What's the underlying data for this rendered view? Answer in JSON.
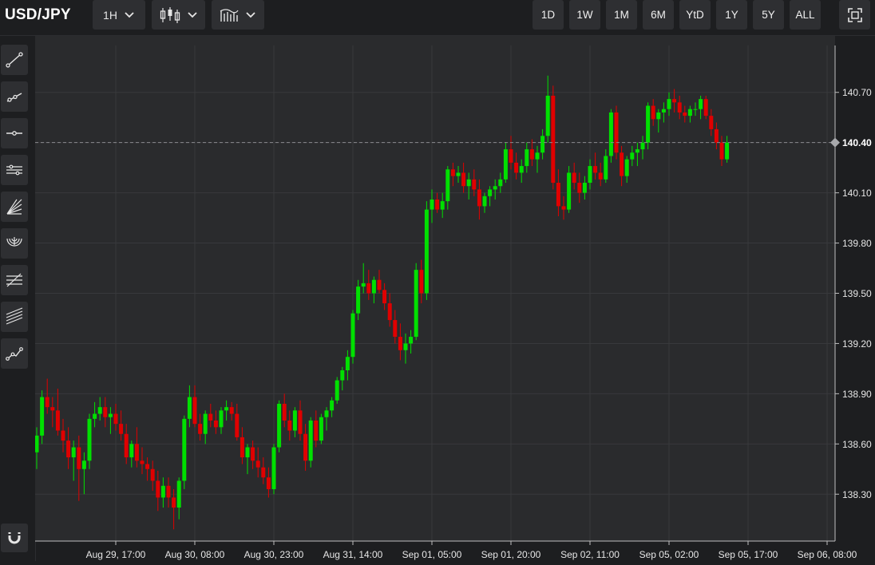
{
  "header": {
    "symbol": "USD/JPY",
    "interval_label": "1H",
    "chart_type_icon": "candlestick-icon",
    "indicators_icon": "indicators-icon",
    "ranges": [
      "1D",
      "1W",
      "1M",
      "6M",
      "YtD",
      "1Y",
      "5Y",
      "ALL"
    ],
    "fullscreen_icon": "fullscreen-icon"
  },
  "sidebar": {
    "tools": [
      "trend-line-icon",
      "ray-line-icon",
      "horizontal-line-icon",
      "parallel-channel-icon",
      "fan-lines-icon",
      "fibonacci-arc-icon",
      "fibonacci-retracement-icon",
      "fibonacci-channel-icon",
      "path-line-icon"
    ],
    "magnet_icon": "magnet-icon"
  },
  "chart_data": {
    "type": "candlestick",
    "title": "USD/JPY",
    "xlabel": "",
    "ylabel": "",
    "y_ticks": [
      138.3,
      138.6,
      138.9,
      139.2,
      139.5,
      139.8,
      140.1,
      140.4,
      140.7
    ],
    "y_tick_labels": [
      "138.30",
      "138.60",
      "138.90",
      "139.20",
      "139.50",
      "139.80",
      "140.10",
      "140.40",
      "140.70"
    ],
    "ylim": [
      138.02,
      140.98
    ],
    "x_tick_labels": [
      "Aug 29, 17:00",
      "Aug 30, 08:00",
      "Aug 30, 23:00",
      "Aug 31, 14:00",
      "Sep 01, 05:00",
      "Sep 01, 20:00",
      "Sep 02, 11:00",
      "Sep 05, 02:00",
      "Sep 05, 17:00",
      "Sep 06, 08:00"
    ],
    "x_tick_candle_index": [
      15,
      30,
      45,
      60,
      75,
      90,
      105,
      120,
      135,
      150
    ],
    "current_price": 140.4,
    "current_price_label": "140.40",
    "up_color": "#00e000",
    "down_color": "#e00000",
    "grid": true,
    "candles": [
      [
        138.55,
        138.7,
        138.45,
        138.65
      ],
      [
        138.65,
        138.92,
        138.6,
        138.88
      ],
      [
        138.88,
        138.99,
        138.78,
        138.82
      ],
      [
        138.82,
        138.88,
        138.7,
        138.8
      ],
      [
        138.8,
        138.93,
        138.65,
        138.68
      ],
      [
        138.68,
        138.75,
        138.55,
        138.62
      ],
      [
        138.62,
        138.7,
        138.45,
        138.52
      ],
      [
        138.52,
        138.62,
        138.38,
        138.58
      ],
      [
        138.58,
        138.65,
        138.26,
        138.45
      ],
      [
        138.45,
        138.55,
        138.3,
        138.5
      ],
      [
        138.5,
        138.78,
        138.45,
        138.75
      ],
      [
        138.75,
        138.85,
        138.7,
        138.78
      ],
      [
        138.78,
        138.88,
        138.74,
        138.82
      ],
      [
        138.82,
        138.88,
        138.7,
        138.76
      ],
      [
        138.76,
        138.82,
        138.66,
        138.78
      ],
      [
        138.78,
        138.84,
        138.68,
        138.72
      ],
      [
        138.72,
        138.8,
        138.62,
        138.66
      ],
      [
        138.66,
        138.72,
        138.48,
        138.52
      ],
      [
        138.52,
        138.62,
        138.46,
        138.6
      ],
      [
        138.6,
        138.7,
        138.46,
        138.5
      ],
      [
        138.5,
        138.58,
        138.42,
        138.48
      ],
      [
        138.48,
        138.52,
        138.38,
        138.45
      ],
      [
        138.45,
        138.5,
        138.32,
        138.38
      ],
      [
        138.38,
        138.44,
        138.2,
        138.28
      ],
      [
        138.28,
        138.4,
        138.22,
        138.35
      ],
      [
        138.35,
        138.4,
        138.22,
        138.28
      ],
      [
        138.28,
        138.33,
        138.09,
        138.22
      ],
      [
        138.22,
        138.4,
        138.15,
        138.38
      ],
      [
        138.38,
        138.77,
        138.33,
        138.75
      ],
      [
        138.75,
        138.95,
        138.7,
        138.88
      ],
      [
        138.88,
        138.95,
        138.7,
        138.72
      ],
      [
        138.72,
        138.78,
        138.62,
        138.66
      ],
      [
        138.66,
        138.8,
        138.6,
        138.78
      ],
      [
        138.78,
        138.84,
        138.7,
        138.74
      ],
      [
        138.74,
        138.8,
        138.66,
        138.7
      ],
      [
        138.7,
        138.82,
        138.66,
        138.8
      ],
      [
        138.8,
        138.86,
        138.74,
        138.82
      ],
      [
        138.82,
        138.85,
        138.74,
        138.78
      ],
      [
        138.78,
        138.84,
        138.62,
        138.64
      ],
      [
        138.64,
        138.7,
        138.48,
        138.52
      ],
      [
        138.52,
        138.6,
        138.42,
        138.58
      ],
      [
        138.58,
        138.62,
        138.45,
        138.5
      ],
      [
        138.5,
        138.58,
        138.4,
        138.46
      ],
      [
        138.46,
        138.52,
        138.36,
        138.4
      ],
      [
        138.4,
        138.46,
        138.28,
        138.33
      ],
      [
        138.33,
        138.6,
        138.3,
        138.58
      ],
      [
        138.58,
        138.86,
        138.55,
        138.84
      ],
      [
        138.84,
        138.9,
        138.7,
        138.74
      ],
      [
        138.74,
        138.8,
        138.62,
        138.68
      ],
      [
        138.68,
        138.82,
        138.64,
        138.8
      ],
      [
        138.8,
        138.86,
        138.62,
        138.66
      ],
      [
        138.66,
        138.72,
        138.44,
        138.5
      ],
      [
        138.5,
        138.76,
        138.46,
        138.74
      ],
      [
        138.74,
        138.8,
        138.58,
        138.62
      ],
      [
        138.62,
        138.78,
        138.6,
        138.76
      ],
      [
        138.76,
        138.82,
        138.68,
        138.8
      ],
      [
        138.8,
        138.88,
        138.76,
        138.86
      ],
      [
        138.86,
        139.0,
        138.84,
        138.98
      ],
      [
        138.98,
        139.06,
        138.92,
        139.04
      ],
      [
        139.04,
        139.16,
        138.98,
        139.12
      ],
      [
        139.12,
        139.4,
        139.08,
        139.38
      ],
      [
        139.38,
        139.58,
        139.34,
        139.54
      ],
      [
        139.54,
        139.68,
        139.5,
        139.56
      ],
      [
        139.56,
        139.64,
        139.46,
        139.5
      ],
      [
        139.5,
        139.6,
        139.44,
        139.58
      ],
      [
        139.58,
        139.64,
        139.5,
        139.52
      ],
      [
        139.52,
        139.56,
        139.4,
        139.44
      ],
      [
        139.44,
        139.5,
        139.3,
        139.34
      ],
      [
        139.34,
        139.4,
        139.2,
        139.24
      ],
      [
        139.24,
        139.32,
        139.1,
        139.16
      ],
      [
        139.16,
        139.26,
        139.08,
        139.2
      ],
      [
        139.2,
        139.28,
        139.14,
        139.24
      ],
      [
        139.24,
        139.68,
        139.22,
        139.64
      ],
      [
        139.64,
        139.7,
        139.44,
        139.5
      ],
      [
        139.5,
        140.05,
        139.46,
        140.0
      ],
      [
        140.0,
        140.12,
        139.92,
        140.06
      ],
      [
        140.06,
        140.1,
        139.98,
        140.0
      ],
      [
        140.0,
        140.1,
        139.95,
        140.05
      ],
      [
        140.05,
        140.26,
        140.0,
        140.24
      ],
      [
        140.24,
        140.28,
        140.14,
        140.2
      ],
      [
        140.2,
        140.26,
        140.16,
        140.22
      ],
      [
        140.22,
        140.28,
        140.1,
        140.14
      ],
      [
        140.14,
        140.22,
        140.06,
        140.18
      ],
      [
        140.18,
        140.24,
        140.08,
        140.12
      ],
      [
        140.12,
        140.18,
        139.94,
        140.02
      ],
      [
        140.02,
        140.1,
        139.98,
        140.08
      ],
      [
        140.08,
        140.14,
        140.02,
        140.12
      ],
      [
        140.12,
        140.18,
        140.06,
        140.14
      ],
      [
        140.14,
        140.22,
        140.1,
        140.18
      ],
      [
        140.18,
        140.4,
        140.16,
        140.36
      ],
      [
        140.36,
        140.44,
        140.24,
        140.28
      ],
      [
        140.28,
        140.34,
        140.18,
        140.22
      ],
      [
        140.22,
        140.3,
        140.16,
        140.26
      ],
      [
        140.26,
        140.4,
        140.22,
        140.36
      ],
      [
        140.36,
        140.42,
        140.26,
        140.3
      ],
      [
        140.3,
        140.38,
        140.22,
        140.34
      ],
      [
        140.34,
        140.48,
        140.3,
        140.44
      ],
      [
        140.44,
        140.8,
        140.4,
        140.68
      ],
      [
        140.68,
        140.74,
        140.12,
        140.16
      ],
      [
        140.16,
        140.24,
        139.96,
        140.02
      ],
      [
        140.02,
        140.08,
        139.94,
        140.0
      ],
      [
        140.0,
        140.26,
        139.98,
        140.22
      ],
      [
        140.22,
        140.28,
        140.12,
        140.16
      ],
      [
        140.16,
        140.22,
        140.04,
        140.1
      ],
      [
        140.1,
        140.2,
        140.06,
        140.16
      ],
      [
        140.16,
        140.3,
        140.12,
        140.26
      ],
      [
        140.26,
        140.34,
        140.18,
        140.22
      ],
      [
        140.22,
        140.28,
        140.14,
        140.18
      ],
      [
        140.18,
        140.36,
        140.16,
        140.32
      ],
      [
        140.32,
        140.6,
        140.28,
        140.58
      ],
      [
        140.58,
        140.62,
        140.3,
        140.34
      ],
      [
        140.34,
        140.38,
        140.14,
        140.2
      ],
      [
        140.2,
        140.32,
        140.16,
        140.3
      ],
      [
        140.3,
        140.38,
        140.26,
        140.34
      ],
      [
        140.34,
        140.4,
        140.26,
        140.36
      ],
      [
        140.36,
        140.44,
        140.3,
        140.4
      ],
      [
        140.4,
        140.64,
        140.36,
        140.62
      ],
      [
        140.62,
        140.66,
        140.5,
        140.54
      ],
      [
        140.54,
        140.6,
        140.46,
        140.58
      ],
      [
        140.58,
        140.64,
        140.52,
        140.6
      ],
      [
        140.6,
        140.7,
        140.56,
        140.66
      ],
      [
        140.66,
        140.72,
        140.58,
        140.64
      ],
      [
        140.64,
        140.68,
        140.54,
        140.58
      ],
      [
        140.58,
        140.62,
        140.52,
        140.56
      ],
      [
        140.56,
        140.62,
        140.52,
        140.6
      ],
      [
        140.6,
        140.64,
        140.56,
        140.6
      ],
      [
        140.6,
        140.68,
        140.54,
        140.66
      ],
      [
        140.66,
        140.68,
        140.54,
        140.56
      ],
      [
        140.56,
        140.6,
        140.44,
        140.48
      ],
      [
        140.48,
        140.52,
        140.36,
        140.4
      ],
      [
        140.4,
        140.44,
        140.26,
        140.3
      ],
      [
        140.3,
        140.44,
        140.28,
        140.4
      ]
    ]
  }
}
